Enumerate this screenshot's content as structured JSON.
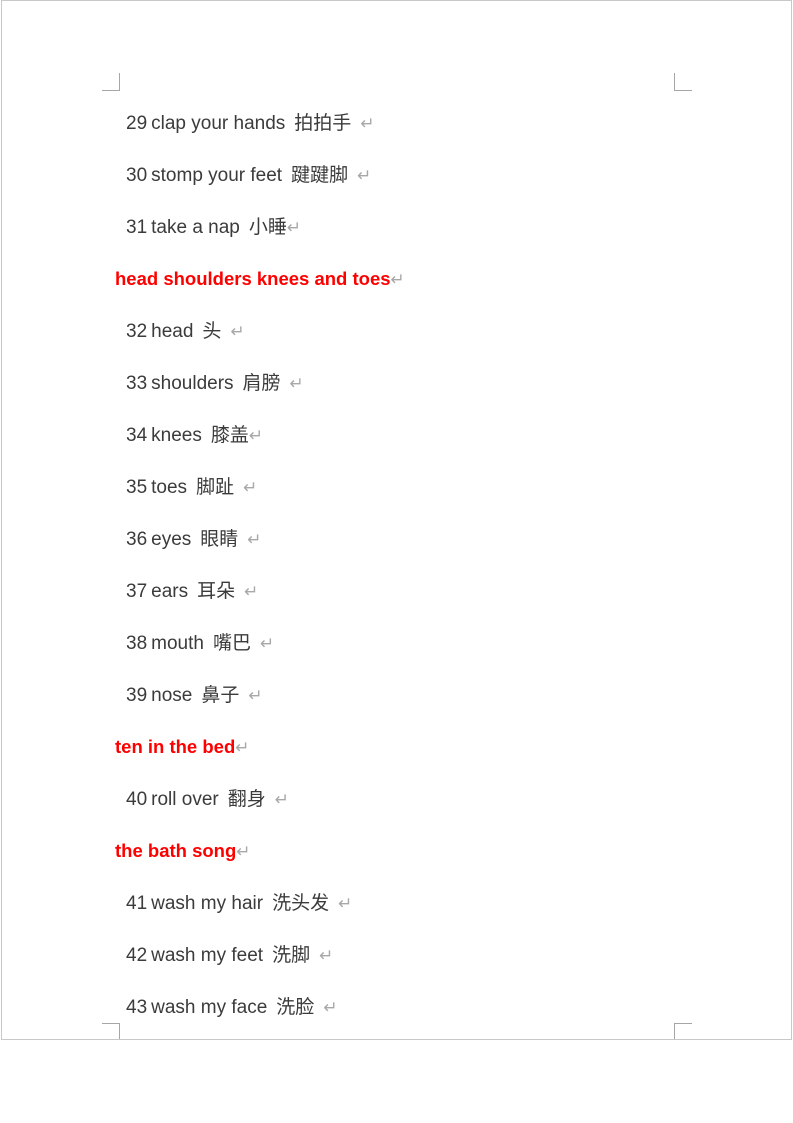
{
  "page": {
    "background_color": "#ffffff",
    "border_color": "#c8c8c8",
    "heading_color": "#ff0000",
    "body_text_color": "#3b3b3b",
    "paragraph_mark_color": "#a8a8a8",
    "paragraph_mark": "↵"
  },
  "lines": [
    {
      "type": "item",
      "number": "29",
      "english": "clap your hands",
      "chinese": "拍拍手",
      "gap": "wide"
    },
    {
      "type": "item",
      "number": "30",
      "english": "stomp your feet",
      "chinese": "踺踺脚",
      "gap": "wide"
    },
    {
      "type": "item",
      "number": "31",
      "english": "take a nap",
      "chinese": "小睡",
      "gap": "none"
    },
    {
      "type": "heading",
      "text": "head shoulders knees and toes"
    },
    {
      "type": "item",
      "number": "32",
      "english": "head",
      "chinese": "头",
      "gap": "wide"
    },
    {
      "type": "item",
      "number": "33",
      "english": "shoulders",
      "chinese": "肩膀",
      "gap": "wide"
    },
    {
      "type": "item",
      "number": "34",
      "english": "knees",
      "chinese": "膝盖",
      "gap": "none"
    },
    {
      "type": "item",
      "number": "35",
      "english": "toes",
      "chinese": "脚趾",
      "gap": "wide"
    },
    {
      "type": "item",
      "number": "36",
      "english": "eyes",
      "chinese": "眼睛",
      "gap": "wide"
    },
    {
      "type": "item",
      "number": "37",
      "english": "ears",
      "chinese": "耳朵",
      "gap": "wide"
    },
    {
      "type": "item",
      "number": "38",
      "english": "mouth",
      "chinese": "嘴巴",
      "gap": "wide"
    },
    {
      "type": "item",
      "number": "39",
      "english": "nose",
      "chinese": "鼻子",
      "gap": "wide"
    },
    {
      "type": "heading",
      "text": "ten in the bed"
    },
    {
      "type": "item",
      "number": "40",
      "english": "roll over",
      "chinese": "翻身",
      "gap": "wide"
    },
    {
      "type": "heading",
      "text": "the bath song"
    },
    {
      "type": "item",
      "number": "41",
      "english": "wash my hair",
      "chinese": "洗头发",
      "gap": "wide"
    },
    {
      "type": "item",
      "number": "42",
      "english": "wash my feet",
      "chinese": "洗脚",
      "gap": "wide"
    },
    {
      "type": "item",
      "number": "43",
      "english": "wash my face",
      "chinese": "洗脸",
      "gap": "wide"
    }
  ],
  "crop_marks": [
    {
      "name": "top-left"
    },
    {
      "name": "top-right"
    },
    {
      "name": "bottom-left"
    },
    {
      "name": "bottom-right"
    }
  ]
}
